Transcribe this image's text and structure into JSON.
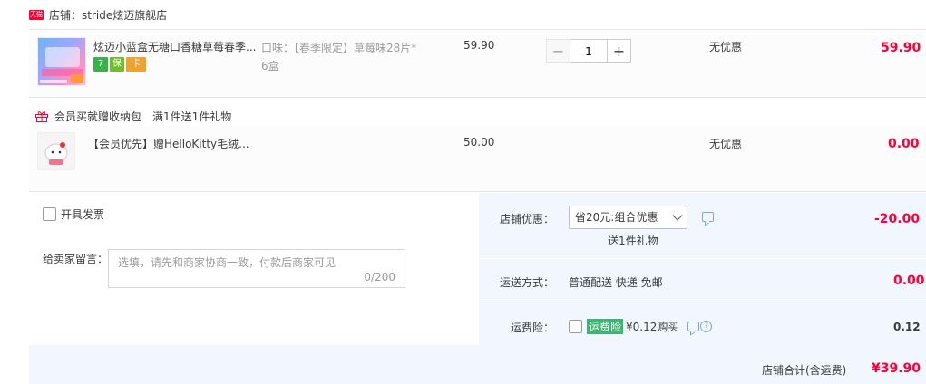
{
  "shop": {
    "badge": "天猫",
    "label": "店铺：stride炫迈旗舰店"
  },
  "item": {
    "title": "炫迈小蓝盒无糖口香糖草莓春季...",
    "sku_line1": "口味：【春季限定】草莓味28片*",
    "sku_line2": "6盒",
    "unit_price": "59.90",
    "quantity": "1",
    "minus": "−",
    "plus": "+",
    "discount": "无优惠",
    "subtotal": "59.90",
    "service_icons": [
      "7",
      "保",
      "卡"
    ]
  },
  "gift_section": {
    "tag": "会员买就赠收纳包",
    "rule": "满1件送1件礼物"
  },
  "gift_item": {
    "title": "【会员优先】赠HelloKitty毛绒...",
    "unit_price": "50.00",
    "discount": "无优惠",
    "subtotal": "0.00"
  },
  "invoice": {
    "label": "开具发票"
  },
  "message": {
    "label": "给卖家留言：",
    "placeholder": "选填，请先和商家协商一致，付款后商家可见",
    "count": "0/200"
  },
  "store_discount": {
    "label": "店铺优惠：",
    "selected": "省20元:组合优惠",
    "gift_note": "送1件礼物",
    "amount": "-20.00"
  },
  "shipping": {
    "label": "运送方式：",
    "value": "普通配送 快递 免邮",
    "amount": "0.00"
  },
  "insurance": {
    "label": "运费险：",
    "tag": "运费险",
    "text": "¥0.12购买",
    "amount": "0.12"
  },
  "total": {
    "label": "店铺合计(含运费)",
    "amount": "¥39.90"
  },
  "colors": {
    "accent_red": "#ff0036",
    "panel_blue": "#f2f7ff",
    "insurance_green": "#3ab76f"
  }
}
